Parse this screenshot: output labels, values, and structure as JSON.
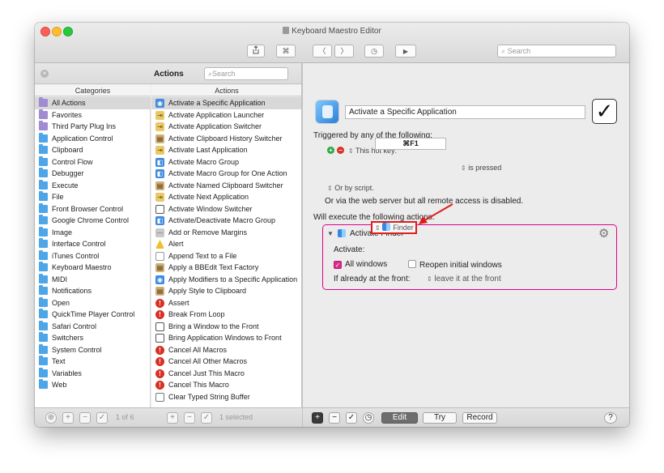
{
  "window": {
    "title": "Keyboard Maestro Editor"
  },
  "toolbar": {
    "share_icon": "share-icon",
    "command_glyph": "⌘",
    "back_glyph": "〈",
    "forward_glyph": "〉",
    "clock_glyph": "◷",
    "play_glyph": "▶",
    "search_placeholder": "Search"
  },
  "actions_panel": {
    "title": "Actions",
    "search_placeholder": "Search",
    "categories_header": "Categories",
    "actions_header": "Actions",
    "categories": [
      {
        "label": "All Actions",
        "icon": "purple-folder-icon",
        "selected": true
      },
      {
        "label": "Favorites",
        "icon": "purple-folder-icon"
      },
      {
        "label": "Third Party Plug Ins",
        "icon": "purple-folder-icon"
      },
      {
        "label": "Application Control",
        "icon": "folder-icon"
      },
      {
        "label": "Clipboard",
        "icon": "folder-icon"
      },
      {
        "label": "Control Flow",
        "icon": "folder-icon"
      },
      {
        "label": "Debugger",
        "icon": "folder-icon"
      },
      {
        "label": "Execute",
        "icon": "folder-icon"
      },
      {
        "label": "File",
        "icon": "folder-icon"
      },
      {
        "label": "Front Browser Control",
        "icon": "folder-icon"
      },
      {
        "label": "Google Chrome Control",
        "icon": "folder-icon"
      },
      {
        "label": "Image",
        "icon": "folder-icon"
      },
      {
        "label": "Interface Control",
        "icon": "folder-icon"
      },
      {
        "label": "iTunes Control",
        "icon": "folder-icon"
      },
      {
        "label": "Keyboard Maestro",
        "icon": "folder-icon"
      },
      {
        "label": "MIDI",
        "icon": "folder-icon"
      },
      {
        "label": "Notifications",
        "icon": "folder-icon"
      },
      {
        "label": "Open",
        "icon": "folder-icon"
      },
      {
        "label": "QuickTime Player Control",
        "icon": "folder-icon"
      },
      {
        "label": "Safari Control",
        "icon": "folder-icon"
      },
      {
        "label": "Switchers",
        "icon": "folder-icon"
      },
      {
        "label": "System Control",
        "icon": "folder-icon"
      },
      {
        "label": "Text",
        "icon": "folder-icon"
      },
      {
        "label": "Variables",
        "icon": "folder-icon"
      },
      {
        "label": "Web",
        "icon": "folder-icon"
      }
    ],
    "actions": [
      {
        "label": "Activate a Specific Application",
        "icon": "app",
        "selected": true
      },
      {
        "label": "Activate Application Launcher",
        "icon": "switch"
      },
      {
        "label": "Activate Application Switcher",
        "icon": "switch"
      },
      {
        "label": "Activate Clipboard History Switcher",
        "icon": "clip"
      },
      {
        "label": "Activate Last Application",
        "icon": "switch"
      },
      {
        "label": "Activate Macro Group",
        "icon": "group"
      },
      {
        "label": "Activate Macro Group for One Action",
        "icon": "group"
      },
      {
        "label": "Activate Named Clipboard Switcher",
        "icon": "clip"
      },
      {
        "label": "Activate Next Application",
        "icon": "switch"
      },
      {
        "label": "Activate Window Switcher",
        "icon": "win"
      },
      {
        "label": "Activate/Deactivate Macro Group",
        "icon": "group"
      },
      {
        "label": "Add or Remove Margins",
        "icon": "gear"
      },
      {
        "label": "Alert",
        "icon": "alert"
      },
      {
        "label": "Append Text to a File",
        "icon": "file"
      },
      {
        "label": "Apply a BBEdit Text Factory",
        "icon": "clip"
      },
      {
        "label": "Apply Modifiers to a Specific Application",
        "icon": "app"
      },
      {
        "label": "Apply Style to Clipboard",
        "icon": "clip"
      },
      {
        "label": "Assert",
        "icon": "red"
      },
      {
        "label": "Break From Loop",
        "icon": "red"
      },
      {
        "label": "Bring a Window to the Front",
        "icon": "win"
      },
      {
        "label": "Bring Application Windows to Front",
        "icon": "win"
      },
      {
        "label": "Cancel All Macros",
        "icon": "red"
      },
      {
        "label": "Cancel All Other Macros",
        "icon": "red"
      },
      {
        "label": "Cancel Just This Macro",
        "icon": "red"
      },
      {
        "label": "Cancel This Macro",
        "icon": "red"
      },
      {
        "label": "Clear Typed String Buffer",
        "icon": "text"
      }
    ],
    "categories_count": "1 of 6",
    "actions_count": "1 selected"
  },
  "editor": {
    "macro_name": "Activate a Specific Application",
    "triggered_label": "Triggered by any of the following:",
    "trigger_type": "This hot key:",
    "hot_key": "⌘F1",
    "key_state": "is pressed",
    "or_by_script": "Or by script.",
    "web_server_note": "Or via the web server but all remote access is disabled.",
    "will_execute_label": "Will execute the following actions:",
    "action": {
      "title": "Activate Finder",
      "activate_label": "Activate:",
      "app_value": "Finder",
      "all_windows_label": "All windows",
      "all_windows_checked": true,
      "reopen_label": "Reopen initial windows",
      "reopen_checked": false,
      "front_label": "If already at the front:",
      "front_value": "leave it at the front"
    },
    "bottom": {
      "edit_label": "Edit",
      "try_label": "Try",
      "record_label": "Record",
      "help_label": "?"
    }
  },
  "colors": {
    "highlight_border": "#e0008a",
    "annotation_red": "#e01b1b",
    "add_green": "#27a844",
    "remove_red": "#d93025"
  }
}
